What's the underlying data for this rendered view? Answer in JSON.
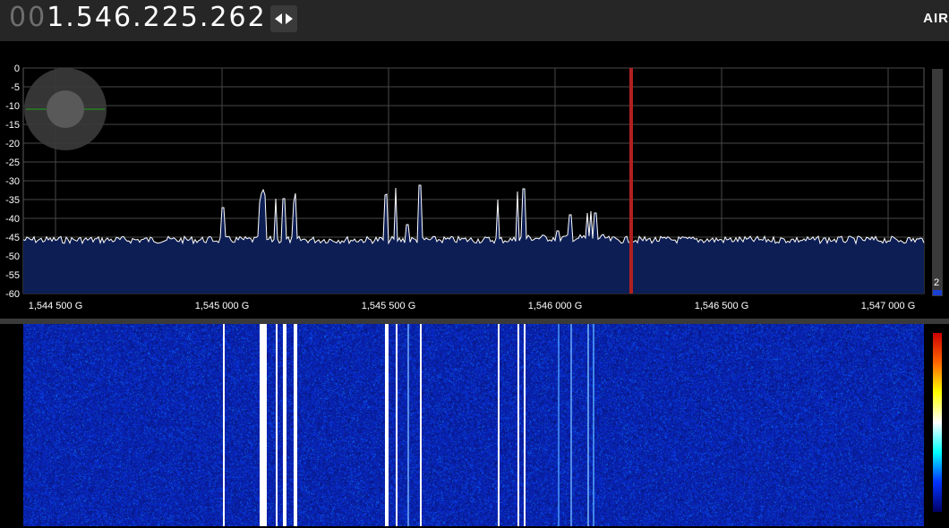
{
  "header": {
    "frequency_leading": "00",
    "frequency_main": "1.546.225.262",
    "brand": "AIR"
  },
  "icons": {
    "tune": "left-right-arrows-icon",
    "zoom": "zoom-joystick-icon"
  },
  "spectrum": {
    "y_ticks": [
      "0",
      "-5",
      "-10",
      "-15",
      "-20",
      "-25",
      "-30",
      "-35",
      "-40",
      "-45",
      "-50",
      "-55",
      "-60"
    ],
    "x_ticks": [
      "1,544 500 G",
      "1,545 000 G",
      "1,545 500 G",
      "1,546 000 G",
      "1,546 500 G",
      "1,547 000 G"
    ],
    "level_value": "2",
    "colors": {
      "trace": "#ffffff",
      "fill": "#0d1e55",
      "marker": "#b02020",
      "grid": "#4a4a4a"
    }
  },
  "waterfall": {
    "palette": [
      "#000066",
      "#0033ff",
      "#00ffff",
      "#ffffff",
      "#ffff00",
      "#ff6600",
      "#cc0000"
    ]
  }
}
